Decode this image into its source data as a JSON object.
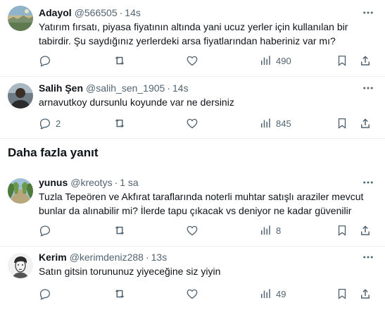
{
  "section_title": "Daha fazla yanıt",
  "tweets": [
    {
      "name": "Adayol",
      "handle": "@566505",
      "separator": "·",
      "time": "14s",
      "lines": [
        "Yatırım fırsatı, piyasa fiyatının altında yani ucuz yerler için kullanılan bir",
        "tabirdir. Şu saydığınız yerlerdeki arsa fiyatlarından haberiniz var mı?"
      ],
      "views": "490",
      "avatar": "landscape-photo"
    },
    {
      "name": "Salih Şen",
      "handle": "@salih_sen_1905",
      "separator": "·",
      "time": "14s",
      "lines": [
        "arnavutkoy dursunlu koyunde var ne dersiniz"
      ],
      "replies": "2",
      "views": "845",
      "avatar": "person-photo"
    },
    {
      "name": "yunus",
      "handle": "@kreotys",
      "separator": "·",
      "time": "1 sa",
      "lines": [
        "Tuzla Tepeören ve Akfırat taraflarında noterli muhtar satışlı araziler mevcut",
        "bunlar da alınabilir mi? İlerde tapu çıkacak vs deniyor ne kadar güvenilir"
      ],
      "views": "8",
      "avatar": "tree-road-photo"
    },
    {
      "name": "Kerim",
      "handle": "@kerimdeniz288",
      "separator": "·",
      "time": "13s",
      "lines": [
        "Satın gitsin torununuz yiyeceğine siz yiyin"
      ],
      "views": "49",
      "avatar": "sketch-portrait"
    }
  ],
  "colors": {
    "text": "#0f1419",
    "muted": "#536471",
    "divider": "#eff3f4"
  }
}
